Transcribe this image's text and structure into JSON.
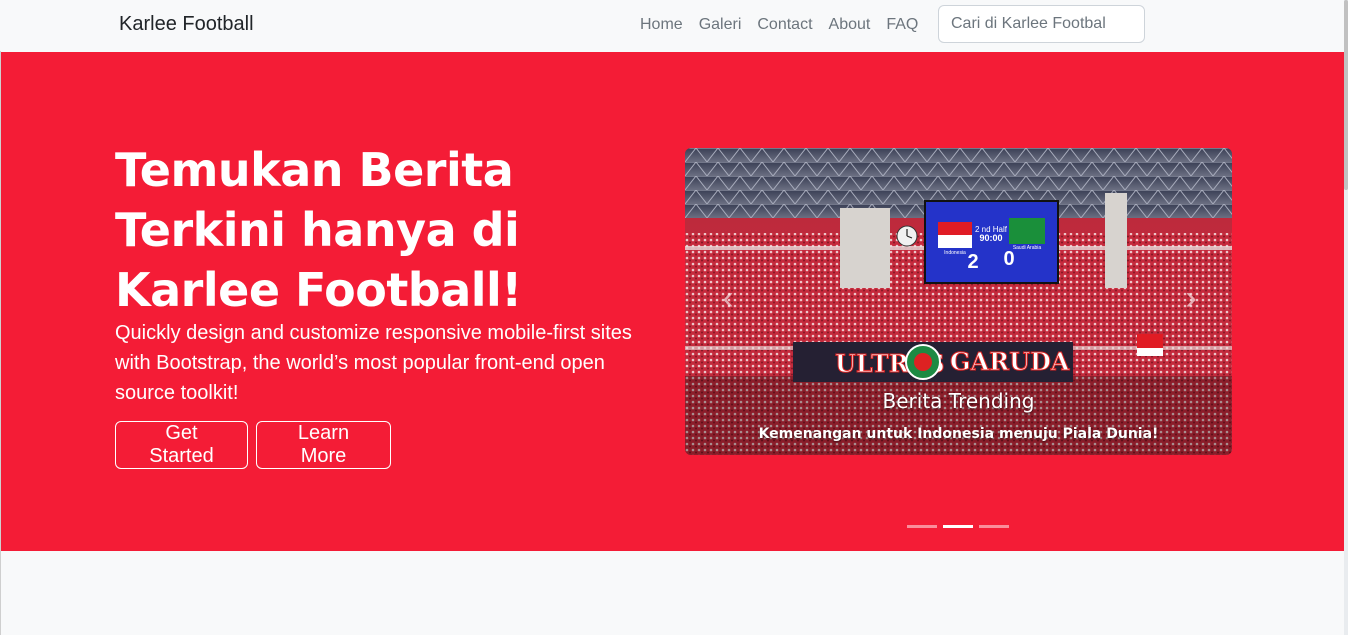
{
  "navbar": {
    "brand": "Karlee Football",
    "links": [
      "Home",
      "Galeri",
      "Contact",
      "About",
      "FAQ"
    ],
    "search_placeholder": "Cari di Karlee Footbal"
  },
  "hero": {
    "title": "Temukan Berita Terkini hanya di Karlee Football!",
    "lead": "Quickly design and customize responsive mobile-first sites with Bootstrap, the world’s most popular front-end open source toolkit!",
    "buttons": {
      "primary": "Get Started",
      "secondary": "Learn More"
    },
    "colors": {
      "background": "#f41c36",
      "text": "#ffffff"
    }
  },
  "carousel": {
    "caption_title": "Berita Trending",
    "caption_text": "Kemenangan untuk Indonesia menuju Piala Dunia!",
    "slide_count": 3,
    "active_slide": 2,
    "image": {
      "banner_text": "ULTRAS GARUDA",
      "scoreboard": {
        "home_team": "Indonesia",
        "away_team": "Saudi Arabia",
        "home_score": "2",
        "away_score": "0",
        "time": "90:00",
        "period": "2 nd Half"
      }
    }
  }
}
